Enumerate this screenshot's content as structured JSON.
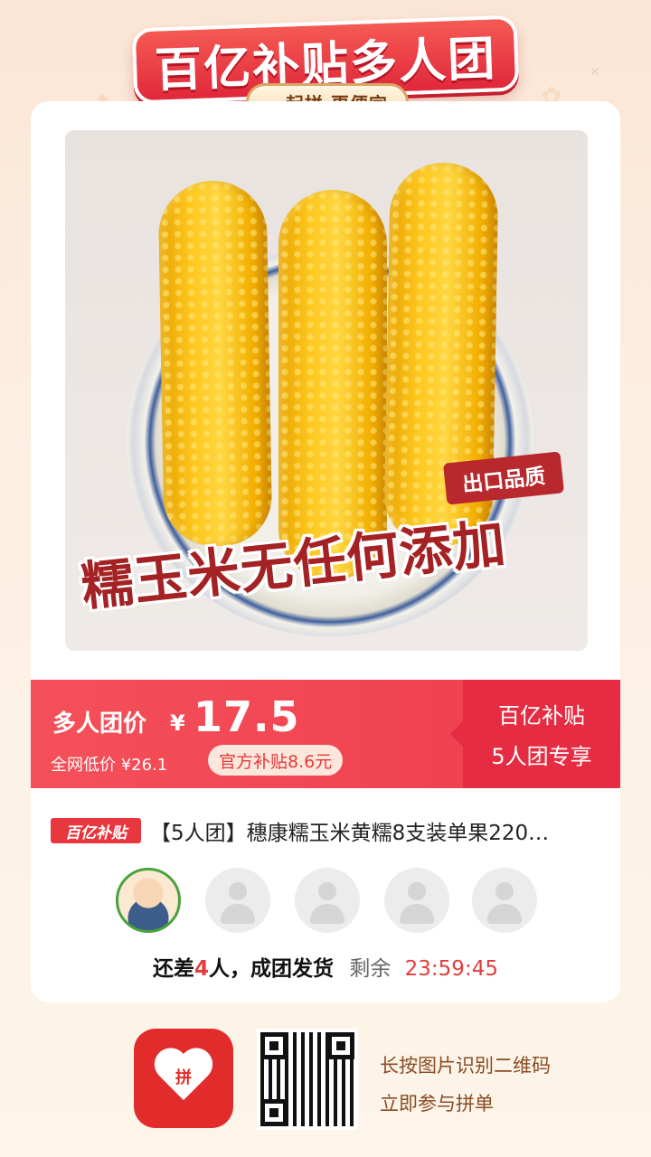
{
  "header": {
    "title": "百亿补贴多人团",
    "subtitle": "一起拼 更便宜"
  },
  "product_image": {
    "badge": "出口品质",
    "slogan": "糯玉米无任何添加"
  },
  "price_bar": {
    "group_label": "多人团价",
    "currency": "¥",
    "price": "17.5",
    "lowest_price": "全网低价 ¥26.1",
    "subsidy": "官方补贴8.6元",
    "right_line1": "百亿补贴",
    "right_line2": "5人团专享"
  },
  "product": {
    "brand_tag": "百亿补贴",
    "title": "【5人团】穗康糯玉米黄糯8支装单果220…"
  },
  "group_status": {
    "prefix": "还差",
    "count": "4",
    "suffix": "人，成团发货",
    "remaining_label": "剩余",
    "timer": "23:59:45"
  },
  "footer": {
    "app_icon_text": "拼",
    "line1": "长按图片识别二维码",
    "line2": "立即参与拼单"
  },
  "colors": {
    "accent_red": "#ef3c4c",
    "dark_red": "#e52c42",
    "background": "#fcefe2"
  }
}
